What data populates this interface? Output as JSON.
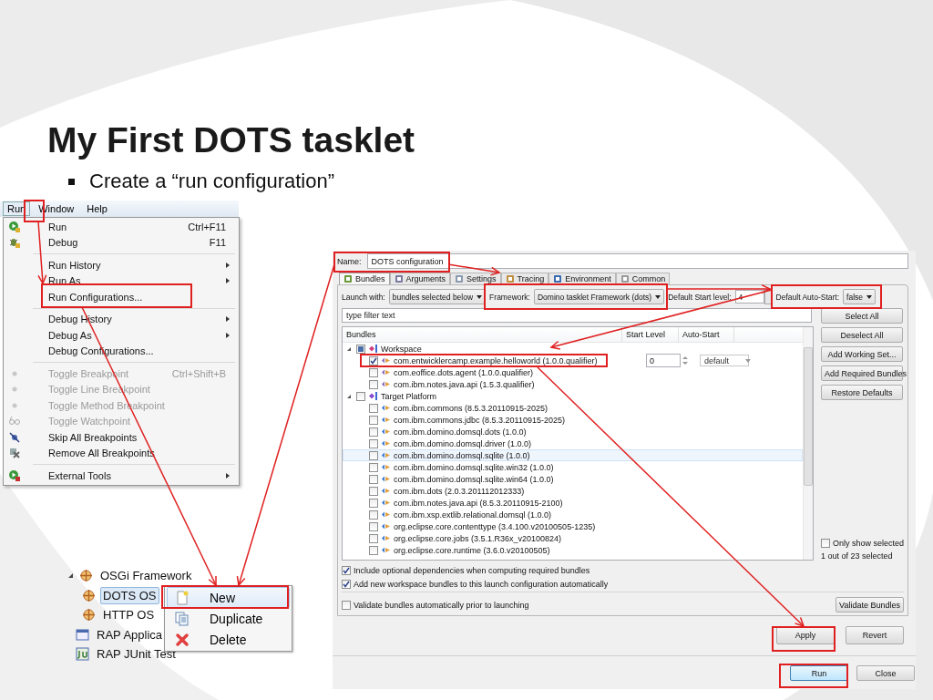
{
  "slide": {
    "title": "My First DOTS tasklet",
    "bullets": [
      "Create a “run configuration”"
    ]
  },
  "menu_window": {
    "menubar": [
      {
        "label": "Run",
        "selected": true
      },
      {
        "label": "Window",
        "selected": false
      },
      {
        "label": "Help",
        "selected": false
      }
    ],
    "items": [
      {
        "kind": "item",
        "label": "Run",
        "shortcut": "Ctrl+F11",
        "disabled": false,
        "submenu": false
      },
      {
        "kind": "item",
        "label": "Debug",
        "shortcut": "F11",
        "disabled": false,
        "submenu": false
      },
      {
        "kind": "separator"
      },
      {
        "kind": "item",
        "label": "Run History",
        "disabled": false,
        "submenu": true
      },
      {
        "kind": "item",
        "label": "Run As",
        "disabled": false,
        "submenu": true
      },
      {
        "kind": "item",
        "label": "Run Configurations...",
        "disabled": false,
        "submenu": false
      },
      {
        "kind": "separator"
      },
      {
        "kind": "item",
        "label": "Debug History",
        "disabled": false,
        "submenu": true
      },
      {
        "kind": "item",
        "label": "Debug As",
        "disabled": false,
        "submenu": true
      },
      {
        "kind": "item",
        "label": "Debug Configurations...",
        "disabled": false,
        "submenu": false
      },
      {
        "kind": "separator"
      },
      {
        "kind": "item",
        "label": "Toggle Breakpoint",
        "shortcut": "Ctrl+Shift+B",
        "disabled": true,
        "submenu": false
      },
      {
        "kind": "item",
        "label": "Toggle Line Breakpoint",
        "disabled": true,
        "submenu": false
      },
      {
        "kind": "item",
        "label": "Toggle Method Breakpoint",
        "disabled": true,
        "submenu": false
      },
      {
        "kind": "item",
        "label": "Toggle Watchpoint",
        "disabled": true,
        "submenu": false
      },
      {
        "kind": "item",
        "label": "Skip All Breakpoints",
        "disabled": false,
        "submenu": false
      },
      {
        "kind": "item",
        "label": "Remove All Breakpoints",
        "disabled": false,
        "submenu": false
      },
      {
        "kind": "separator"
      },
      {
        "kind": "item",
        "label": "External Tools",
        "disabled": false,
        "submenu": true
      }
    ]
  },
  "dialog": {
    "name": {
      "label": "Name:",
      "value": "DOTS configuration"
    },
    "tabs": [
      {
        "label": "Bundles",
        "selected": true
      },
      {
        "label": "Arguments",
        "selected": false
      },
      {
        "label": "Settings",
        "selected": false
      },
      {
        "label": "Tracing",
        "selected": false
      },
      {
        "label": "Environment",
        "selected": false
      },
      {
        "label": "Common",
        "selected": false
      }
    ],
    "launch_with": {
      "label": "Launch with:",
      "value": "bundles selected below"
    },
    "framework": {
      "label": "Framework:",
      "value": "Domino tasklet Framework (dots)"
    },
    "start_level": {
      "label": "Default Start level:",
      "value": "4"
    },
    "auto_start": {
      "label": "Default Auto-Start:",
      "value": "false"
    },
    "filter": {
      "placeholder": "type filter text"
    },
    "columns": [
      "Bundles",
      "Start Level",
      "Auto-Start"
    ],
    "groups": [
      {
        "label": "Workspace",
        "checked": false,
        "partial": true,
        "expanded": true,
        "selected": false,
        "children": [
          {
            "label": "com.entwicklercamp.example.helloworld (1.0.0.qualifier)",
            "checked": true,
            "selected": false,
            "start_level": "0",
            "auto_start": "default"
          },
          {
            "label": "com.eoffice.dots.agent (1.0.0.qualifier)",
            "checked": false,
            "selected": false
          },
          {
            "label": "com.ibm.notes.java.api (1.5.3.qualifier)",
            "checked": false,
            "selected": false
          }
        ]
      },
      {
        "label": "Target Platform",
        "checked": false,
        "partial": false,
        "expanded": true,
        "selected": false,
        "children": [
          {
            "label": "com.ibm.commons (8.5.3.20110915-2025)",
            "checked": false,
            "selected": false
          },
          {
            "label": "com.ibm.commons.jdbc (8.5.3.20110915-2025)",
            "checked": false,
            "selected": false
          },
          {
            "label": "com.ibm.domino.domsql.dots (1.0.0)",
            "checked": false,
            "selected": false
          },
          {
            "label": "com.ibm.domino.domsql.driver (1.0.0)",
            "checked": false,
            "selected": false
          },
          {
            "label": "com.ibm.domino.domsql.sqlite (1.0.0)",
            "checked": false,
            "selected": true
          },
          {
            "label": "com.ibm.domino.domsql.sqlite.win32 (1.0.0)",
            "checked": false,
            "selected": false
          },
          {
            "label": "com.ibm.domino.domsql.sqlite.win64 (1.0.0)",
            "checked": false,
            "selected": false
          },
          {
            "label": "com.ibm.dots (2.0.3.201112012333)",
            "checked": false,
            "selected": false
          },
          {
            "label": "com.ibm.notes.java.api (8.5.3.20110915-2100)",
            "checked": false,
            "selected": false
          },
          {
            "label": "com.ibm.xsp.extlib.relational.domsql (1.0.0)",
            "checked": false,
            "selected": false
          },
          {
            "label": "org.eclipse.core.contenttype (3.4.100.v20100505-1235)",
            "checked": false,
            "selected": false
          },
          {
            "label": "org.eclipse.core.jobs (3.5.1.R36x_v20100824)",
            "checked": false,
            "selected": false
          },
          {
            "label": "org.eclipse.core.runtime (3.6.0.v20100505)",
            "checked": false,
            "selected": false
          }
        ]
      }
    ],
    "side_buttons": [
      "Select All",
      "Deselect All",
      "Add Working Set...",
      "Add Required Bundles",
      "Restore Defaults"
    ],
    "only_show_selected": {
      "label": "Only show selected",
      "checked": false
    },
    "selection_count": "1 out of 23 selected",
    "options": [
      {
        "label": "Include optional dependencies when computing required bundles",
        "checked": true
      },
      {
        "label": "Add new workspace bundles to this launch configuration automatically",
        "checked": true
      }
    ],
    "validate_option": {
      "label": "Validate bundles automatically prior to launching",
      "checked": false
    },
    "validate_button": "Validate Bundles",
    "apply_buttons": [
      "Apply",
      "Revert"
    ],
    "footer_buttons": [
      {
        "label": "Run",
        "default": true
      },
      {
        "label": "Close",
        "default": false
      }
    ]
  },
  "launch_tree": {
    "items": [
      {
        "label": "OSGi Framework",
        "expanded": true,
        "selected": false,
        "children": [
          {
            "label": "DOTS OS",
            "selected": true
          },
          {
            "label": "HTTP OS",
            "selected": false
          }
        ]
      },
      {
        "label": "RAP Applica",
        "selected": false
      },
      {
        "label": "RAP JUnit Test",
        "selected": false
      }
    ]
  },
  "context_menu": {
    "items": [
      {
        "label": "New",
        "selected": true
      },
      {
        "label": "Duplicate",
        "selected": false
      },
      {
        "label": "Delete",
        "selected": false
      }
    ]
  }
}
